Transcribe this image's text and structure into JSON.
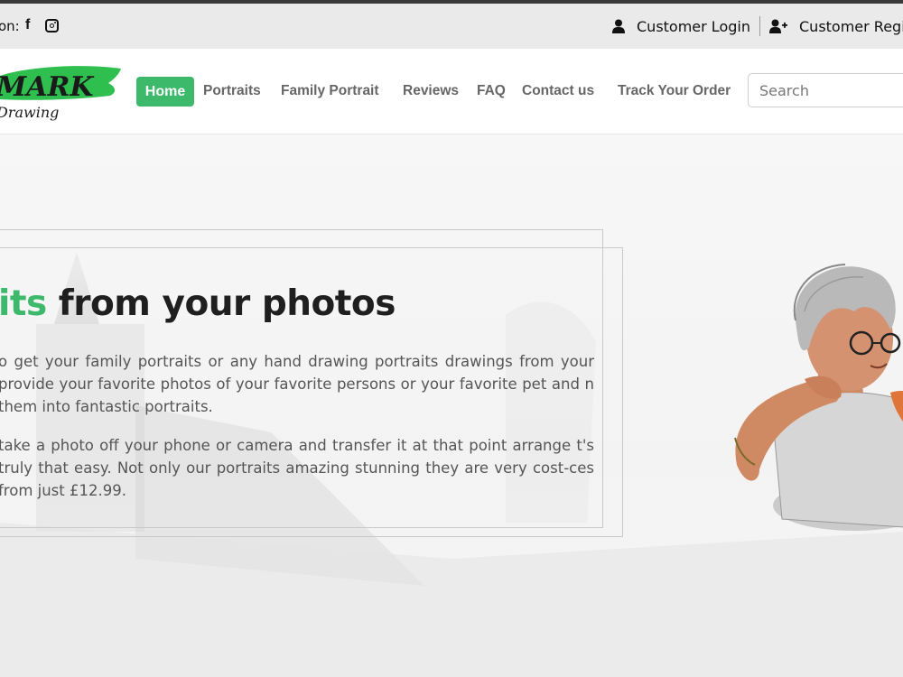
{
  "topbar": {
    "follow_label": "on:",
    "facebook_glyph": "f",
    "icons": [
      "facebook-icon",
      "instagram-icon",
      "user-icon",
      "user-plus-icon"
    ],
    "customer_login": "Customer Login",
    "customer_register": "Customer Regi"
  },
  "nav": {
    "logo_text": "MARK",
    "logo_subtext": "Drawing",
    "items": [
      "Home",
      "Portraits",
      "Family Portrait",
      "Reviews",
      "FAQ",
      "Contact us",
      "Track Your Order"
    ],
    "search_placeholder": "Search"
  },
  "hero": {
    "headline_accent": "its",
    "headline_rest": " from your photos",
    "para1": "o get your family portraits or any hand drawing portraits drawings from your provide your favorite photos of your favorite persons or your favorite pet and n them into fantastic portraits.",
    "para2": "take a photo off your phone or camera and transfer it at that point arrange t's truly that easy. Not only our portraits amazing stunning they are very cost-ces from just £12.99."
  },
  "colors": {
    "accent": "#3cb96a",
    "topbar_bg": "#eaeaea",
    "text_dark": "#1f1f1f",
    "text_muted": "#555555"
  }
}
